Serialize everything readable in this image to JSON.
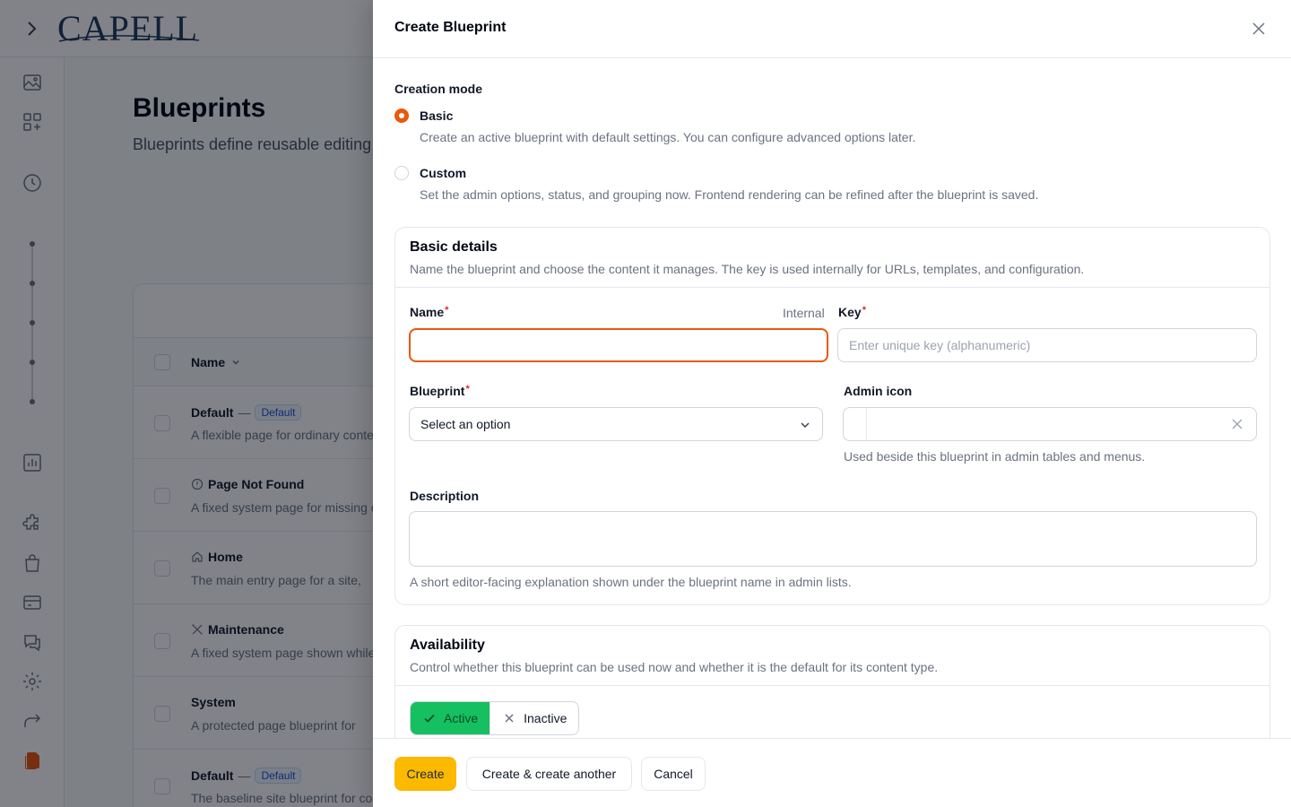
{
  "app": {
    "logo": "CAPELL",
    "page_title": "Blueprints",
    "page_subtitle": "Blueprints define reusable editing",
    "table": {
      "name_header": "Name",
      "rows": [
        {
          "title": "Default",
          "badge": "Default",
          "description": "A flexible page for ordinary content",
          "icon": ""
        },
        {
          "title": "Page Not Found",
          "badge": "",
          "description": "A fixed system page for missing content",
          "icon": "info-circle-icon"
        },
        {
          "title": "Home",
          "badge": "",
          "description": "The main entry page for a site,",
          "icon": "home-icon"
        },
        {
          "title": "Maintenance",
          "badge": "",
          "description": "A fixed system page shown while",
          "icon": "wrench-icon"
        },
        {
          "title": "System",
          "badge": "",
          "description": "A protected page blueprint for",
          "icon": ""
        },
        {
          "title": "Default",
          "badge": "Default",
          "description": "The baseline site blueprint for content",
          "icon": ""
        }
      ],
      "dash": "—"
    }
  },
  "modal": {
    "title": "Create Blueprint",
    "creation_mode": {
      "label": "Creation mode",
      "options": [
        {
          "title": "Basic",
          "description": "Create an active blueprint with default settings. You can configure advanced options later.",
          "selected": true
        },
        {
          "title": "Custom",
          "description": "Set the admin options, status, and grouping now. Frontend rendering can be refined after the blueprint is saved.",
          "selected": false
        }
      ]
    },
    "basic_details": {
      "title": "Basic details",
      "description": "Name the blueprint and choose the content it manages. The key is used internally for URLs, templates, and configuration.",
      "name_label": "Name",
      "name_hint": "Internal",
      "name_value": "",
      "key_label": "Key",
      "key_placeholder": "Enter unique key (alphanumeric)",
      "blueprint_label": "Blueprint",
      "blueprint_value": "Select an option",
      "admin_icon_label": "Admin icon",
      "admin_icon_help": "Used beside this blueprint in admin tables and menus.",
      "description_label": "Description",
      "description_help": "A short editor-facing explanation shown under the blueprint name in admin lists.",
      "required_marker": "*"
    },
    "availability": {
      "title": "Availability",
      "description": "Control whether this blueprint can be used now and whether it is the default for its content type.",
      "active_label": "Active",
      "inactive_label": "Inactive"
    },
    "footer": {
      "create": "Create",
      "create_another": "Create & create another",
      "cancel": "Cancel"
    }
  },
  "colors": {
    "accent": "#ea580c",
    "primary_button": "#fbb900",
    "active_toggle": "#16c060",
    "required": "#dc2626"
  }
}
